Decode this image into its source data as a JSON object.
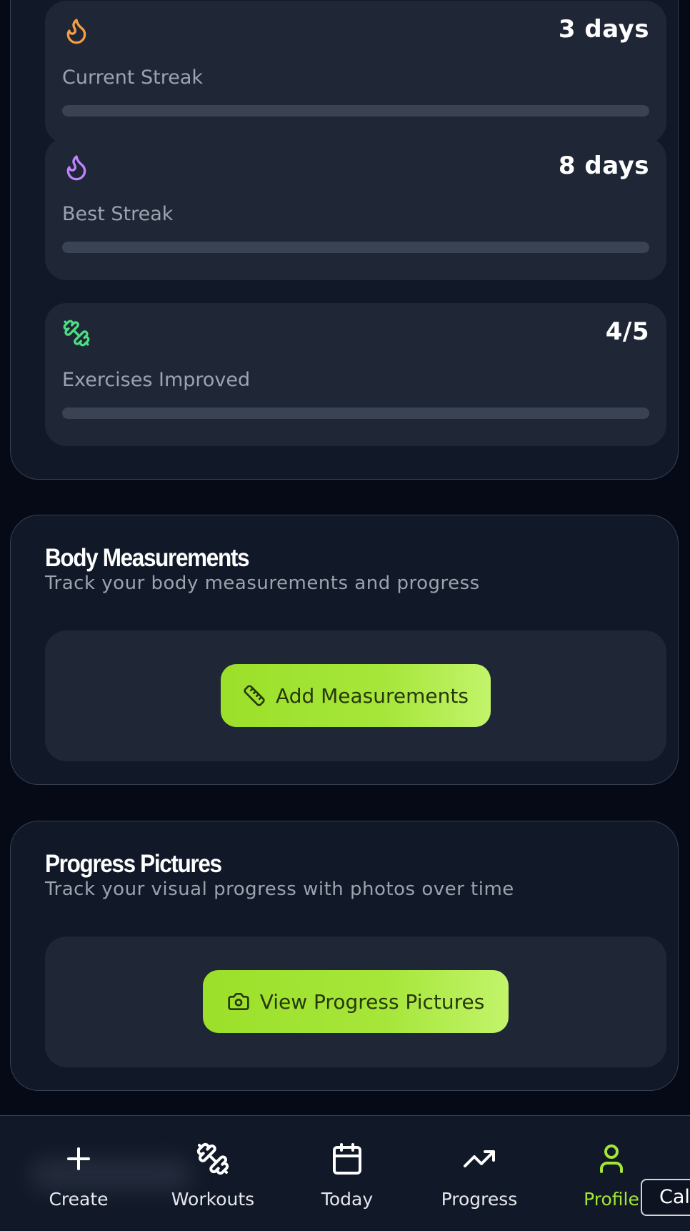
{
  "stats": [
    {
      "value": "3 days",
      "label": "Current Streak",
      "icon": "flame-icon",
      "icon_color": "#f59e42",
      "progress": 0
    },
    {
      "value": "8 days",
      "label": "Best Streak",
      "icon": "flame-icon",
      "icon_color": "#c084fc",
      "progress": 0
    },
    {
      "value": "4/5",
      "label": "Exercises Improved",
      "icon": "dumbbell-icon",
      "icon_color": "#4ade80",
      "progress": 0
    }
  ],
  "body_measurements": {
    "title": "Body Measurements",
    "subtitle": "Track your body measurements and progress",
    "button_label": "Add Measurements",
    "button_icon": "ruler-icon"
  },
  "progress_pictures": {
    "title": "Progress Pictures",
    "subtitle": "Track your visual progress with photos over time",
    "button_label": "View Progress Pictures",
    "button_icon": "camera-icon"
  },
  "nav": {
    "items": [
      {
        "label": "Create",
        "icon": "plus-icon",
        "active": false
      },
      {
        "label": "Workouts",
        "icon": "dumbbell-icon",
        "active": false
      },
      {
        "label": "Today",
        "icon": "calendar-icon",
        "active": false
      },
      {
        "label": "Progress",
        "icon": "trending-up-icon",
        "active": false
      },
      {
        "label": "Profile",
        "icon": "user-icon",
        "active": true
      }
    ]
  },
  "tooltip": {
    "text": "Calendar"
  },
  "colors": {
    "background": "#050a16",
    "card": "#111827",
    "panel": "#1f2737",
    "accent": "#a3e635",
    "muted_text": "#9ca3af"
  }
}
